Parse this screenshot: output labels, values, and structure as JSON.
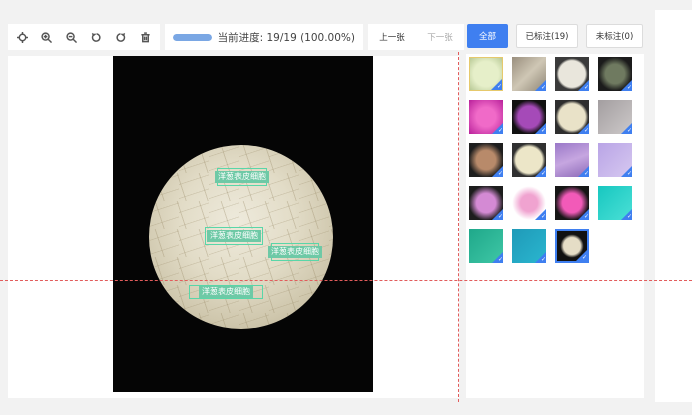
{
  "toolbar": {
    "tools": [
      {
        "name": "crosshair-icon"
      },
      {
        "name": "zoom-in-icon"
      },
      {
        "name": "zoom-out-icon"
      },
      {
        "name": "rotate-left-icon"
      },
      {
        "name": "rotate-right-icon"
      },
      {
        "name": "trash-icon"
      }
    ]
  },
  "progress": {
    "text": "当前进度: 19/19 (100.00%)",
    "fraction": 1.0,
    "color": "#7aa7e4"
  },
  "nav": {
    "prev_label": "上一张",
    "next_label": "下一张"
  },
  "filters": {
    "all_label": "全部",
    "labeled_label": "已标注(19)",
    "unlabeled_label": "未标注(0)"
  },
  "annotations": [
    {
      "label": "洋葱表皮细胞"
    },
    {
      "label": "洋葱表皮细胞"
    },
    {
      "label": "洋葱表皮细胞"
    },
    {
      "label": "洋葱表皮细胞"
    }
  ],
  "colors": {
    "accent": "#3f7ff0",
    "bbox": "#59d6a8",
    "guide": "#e25c5c"
  }
}
